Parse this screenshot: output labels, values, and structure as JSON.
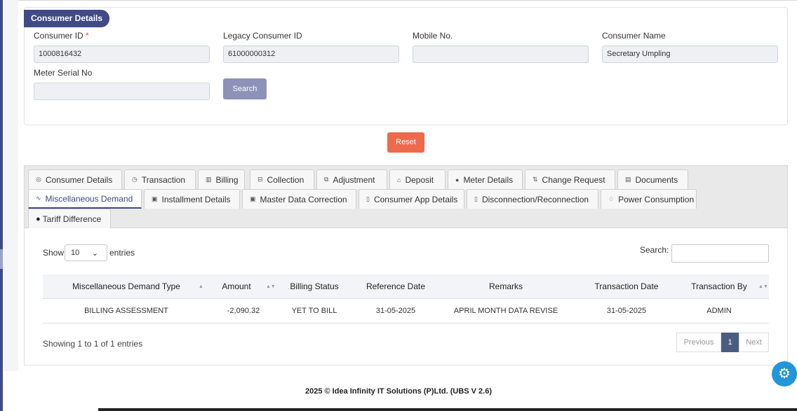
{
  "consumer_details": {
    "section_title": "Consumer Details",
    "consumer_id": {
      "label": "Consumer ID",
      "required_mark": "*",
      "value": "1000816432"
    },
    "legacy_consumer_id": {
      "label": "Legacy Consumer ID",
      "value": "61000000312"
    },
    "mobile_no": {
      "label": "Mobile No.",
      "value": ""
    },
    "consumer_name": {
      "label": "Consumer Name",
      "value": "Secretary  Umpling"
    },
    "meter_serial_no": {
      "label": "Meter Serial No",
      "value": ""
    },
    "search_label": "Search",
    "reset_label": "Reset"
  },
  "tabs": [
    {
      "label": "Consumer Details",
      "icon": "eye-icon"
    },
    {
      "label": "Transaction",
      "icon": "clock-icon"
    },
    {
      "label": "Billing",
      "icon": "chart-icon"
    },
    {
      "label": "Collection",
      "icon": "list-icon"
    },
    {
      "label": "Adjustment",
      "icon": "edit-icon"
    },
    {
      "label": "Deposit",
      "icon": "bank-icon"
    },
    {
      "label": "Meter Details",
      "icon": "gauge-icon"
    },
    {
      "label": "Change Request",
      "icon": "swap-icon"
    },
    {
      "label": "Documents",
      "icon": "document-icon"
    },
    {
      "label": "Miscellaneous Demand",
      "icon": "pulse-icon",
      "active": true
    },
    {
      "label": "Installment Details",
      "icon": "calculator-icon"
    },
    {
      "label": "Master Data Correction",
      "icon": "calculator-icon"
    },
    {
      "label": "Consumer App Details",
      "icon": "mobile-icon"
    },
    {
      "label": "Disconnection/Reconnection",
      "icon": "mobile-icon"
    },
    {
      "label": "Power Consumption",
      "icon": "bulb-icon"
    },
    {
      "label": "Tariff Difference",
      "icon": "circle-icon"
    }
  ],
  "table": {
    "show_label": "Show",
    "entries_value": "10",
    "entries_label": "entries",
    "search_label": "Search:",
    "columns": [
      "Miscellaneous Demand Type",
      "Amount",
      "Billing Status",
      "Reference Date",
      "Remarks",
      "Transaction Date",
      "Transaction By"
    ],
    "rows": [
      [
        "BILLING ASSESSMENT",
        "-2,090.32",
        "YET TO BILL",
        "31-05-2025",
        "APRIL MONTH DATA REVISE",
        "31-05-2025",
        "ADMIN"
      ]
    ],
    "info": "Showing 1 to 1 of 1 entries",
    "pagination": {
      "previous": "Previous",
      "current": "1",
      "next": "Next"
    }
  },
  "footer": "2025 © Idea Infinity IT Solutions (P)Ltd. (UBS V 2.6)",
  "colors": {
    "accent": "#3f4a86",
    "reset": "#ee6a4c",
    "fab": "#2196d8",
    "pager_active": "#4a5d81"
  }
}
